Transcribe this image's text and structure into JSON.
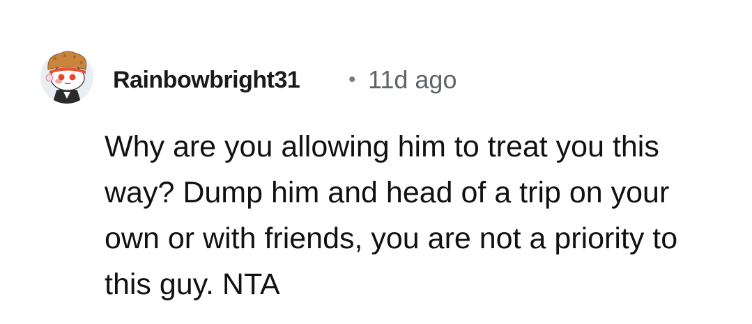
{
  "comment": {
    "username": "Rainbowbright31",
    "separator": "•",
    "timestamp": "11d ago",
    "body": "Why are you allowing him to treat you this way? Dump him and head of a trip on your own or with friends, you are not a priority to this guy. NTA",
    "avatar": {
      "icon": "snoo-avatar-icon"
    }
  },
  "colors": {
    "username": "#1a1a1b",
    "timestamp": "#5f6368",
    "body": "#111111",
    "background": "#ffffff"
  }
}
